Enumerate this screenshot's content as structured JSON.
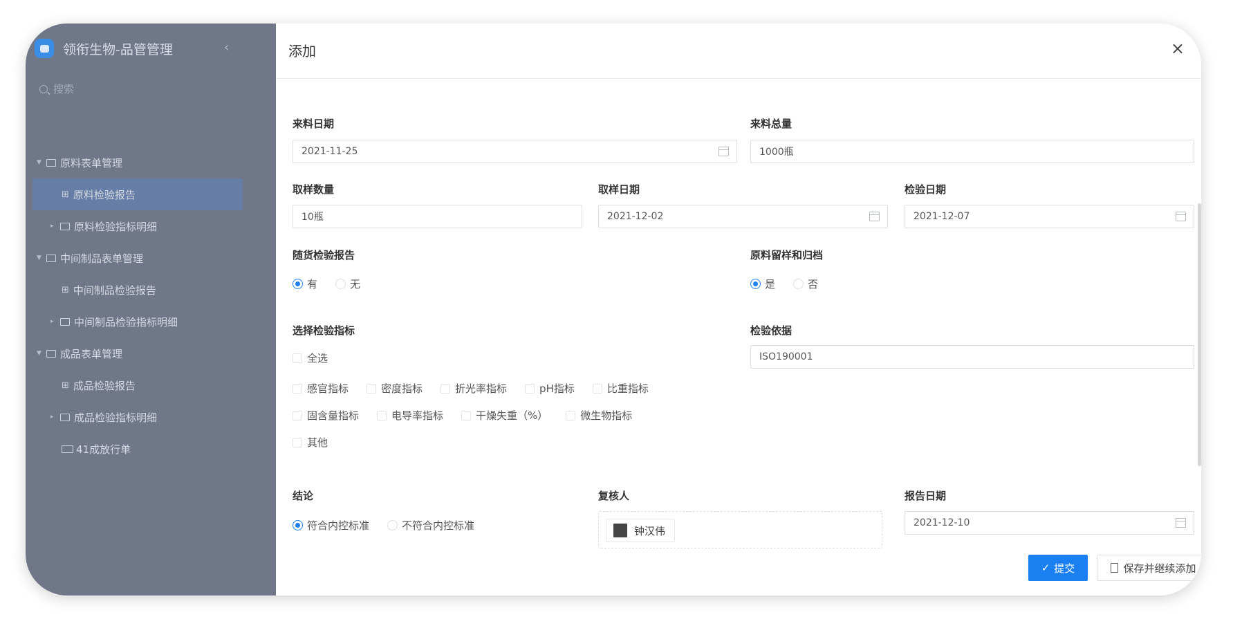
{
  "sidebar": {
    "title": "领衔生物-品管管理",
    "search_placeholder": "搜索",
    "items": [
      {
        "label": "原料表单管理"
      },
      {
        "label": "原料检验报告"
      },
      {
        "label": "原料检验指标明细"
      },
      {
        "label": "中间制品表单管理"
      },
      {
        "label": "中间制品检验报告"
      },
      {
        "label": "中间制品检验指标明细"
      },
      {
        "label": "成品表单管理"
      },
      {
        "label": "成品检验报告"
      },
      {
        "label": "成品检验指标明细"
      },
      {
        "label": "41成放行单"
      }
    ]
  },
  "dialog": {
    "title": "添加",
    "close": "×",
    "fields": {
      "arrival_date": {
        "label": "来料日期",
        "value": "2021-11-25"
      },
      "arrival_total": {
        "label": "来料总量",
        "value": "1000瓶"
      },
      "sample_qty": {
        "label": "取样数量",
        "value": "10瓶"
      },
      "sample_date": {
        "label": "取样日期",
        "value": "2021-12-02"
      },
      "inspect_date": {
        "label": "检验日期",
        "value": "2021-12-07"
      },
      "shipping_report": {
        "label": "随货检验报告",
        "options": [
          "有",
          "无"
        ],
        "selected": "有"
      },
      "retain_archive": {
        "label": "原料留样和归档",
        "options": [
          "是",
          "否"
        ],
        "selected": "是"
      },
      "indicators": {
        "label": "选择检验指标",
        "select_all": "全选",
        "row1": [
          "感官指标",
          "密度指标",
          "折光率指标",
          "pH指标",
          "比重指标"
        ],
        "row2": [
          "固含量指标",
          "电导率指标",
          "干燥失重（%）",
          "微生物指标"
        ],
        "row3": [
          "其他"
        ]
      },
      "basis": {
        "label": "检验依据",
        "value": "ISO190001"
      },
      "conclusion": {
        "label": "结论",
        "options": [
          "符合内控标准",
          "不符合内控标准"
        ],
        "selected": "符合内控标准"
      },
      "reviewer": {
        "label": "复核人",
        "value": "钟汉伟"
      },
      "report_date": {
        "label": "报告日期",
        "value": "2021-12-10"
      }
    },
    "buttons": {
      "submit": "提交",
      "save_continue": "保存并继续添加"
    }
  }
}
